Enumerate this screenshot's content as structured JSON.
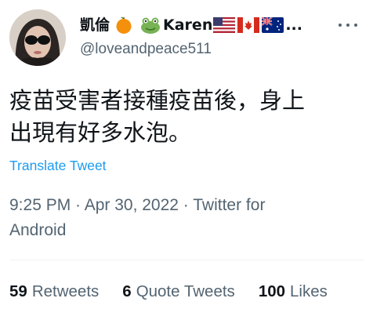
{
  "author": {
    "display_name": "凱倫",
    "display_name_suffix": "Karen",
    "handle": "@loveandpeace511",
    "emojis": [
      "orange-emoji",
      "frog-emoji",
      "us-flag",
      "canada-flag",
      "australia-flag"
    ],
    "truncation": "..."
  },
  "tweet": {
    "text_line1": "疫苗受害者接種疫苗後，身上",
    "text_line2": "出現有好多水泡。",
    "translate_label": "Translate Tweet",
    "meta_line1": "9:25 PM · Apr 30, 2022 · Twitter for",
    "meta_line2": "Android"
  },
  "stats": {
    "retweets_count": "59",
    "retweets_label": "Retweets",
    "quote_count": "6",
    "quote_label": "Quote Tweets",
    "likes_count": "100",
    "likes_label": "Likes"
  },
  "colors": {
    "text": "#0f1419",
    "secondary": "#536471",
    "link": "#1d9bf0",
    "divider": "#eff3f4"
  }
}
